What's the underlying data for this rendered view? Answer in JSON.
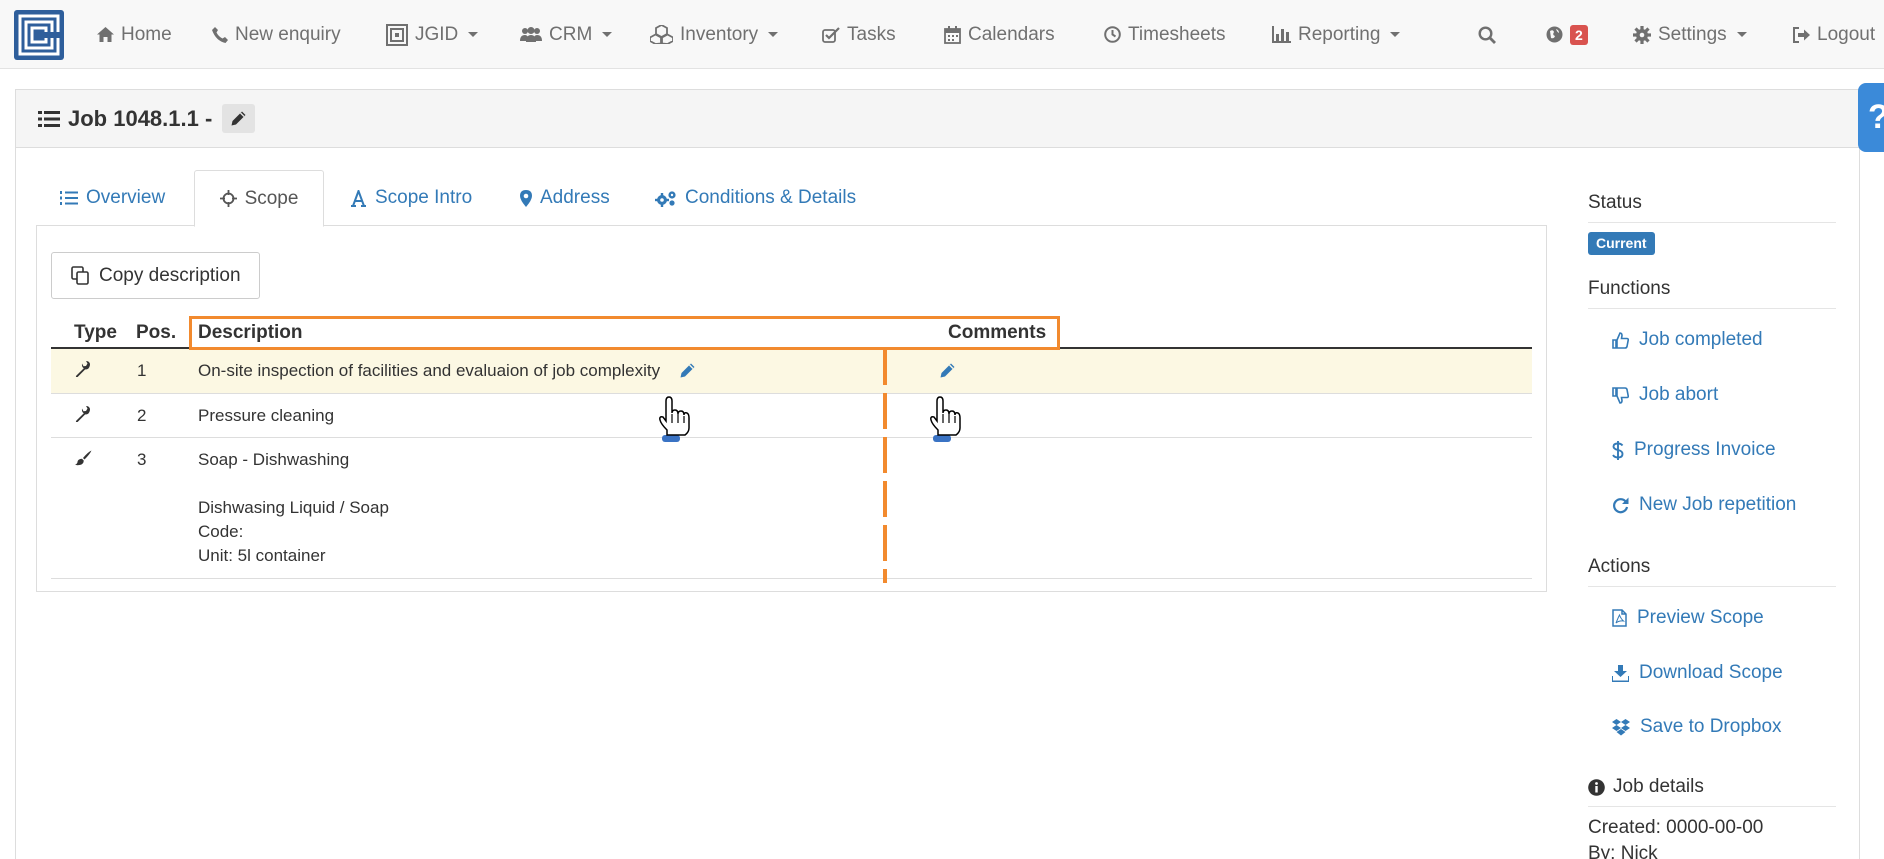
{
  "nav": {
    "home": "Home",
    "new_enquiry": "New enquiry",
    "jgid": "JGID",
    "crm": "CRM",
    "inventory": "Inventory",
    "tasks": "Tasks",
    "calendars": "Calendars",
    "timesheets": "Timesheets",
    "reporting": "Reporting",
    "notifications_count": "2",
    "settings": "Settings",
    "logout": "Logout"
  },
  "page": {
    "title": "Job 1048.1.1 -",
    "help_glyph": "?"
  },
  "tabs": [
    {
      "label": "Overview"
    },
    {
      "label": "Scope"
    },
    {
      "label": "Scope Intro"
    },
    {
      "label": "Address"
    },
    {
      "label": "Conditions & Details"
    }
  ],
  "scope": {
    "copy_button": "Copy description",
    "columns": {
      "type": "Type",
      "pos": "Pos.",
      "description": "Description",
      "comments": "Comments"
    },
    "rows": [
      {
        "icon": "wrench-icon",
        "pos": "1",
        "description": "On-site inspection of facilities and evaluaion of job complexity"
      },
      {
        "icon": "wrench-icon",
        "pos": "2",
        "description": "Pressure cleaning"
      },
      {
        "icon": "brush-icon",
        "pos": "3",
        "description": "Soap - Dishwashing",
        "detail_name": "Dishwasing Liquid / Soap",
        "detail_code": "Code:",
        "detail_unit": "Unit: 5l container"
      }
    ]
  },
  "sidebar": {
    "status_heading": "Status",
    "status_value": "Current",
    "functions_heading": "Functions",
    "functions": [
      "Job completed",
      "Job abort",
      "Progress Invoice",
      "New Job repetition"
    ],
    "actions_heading": "Actions",
    "actions": [
      "Preview Scope",
      "Download Scope",
      "Save to Dropbox"
    ],
    "details_heading": "Job details",
    "created": "Created: 0000-00-00",
    "by": "By: Nick"
  },
  "colors": {
    "link": "#337ab7",
    "annotation": "#f28a2e",
    "highlight_row": "#fcf8e3",
    "status_badge": "#337ab7",
    "notification_badge": "#d9534f"
  }
}
